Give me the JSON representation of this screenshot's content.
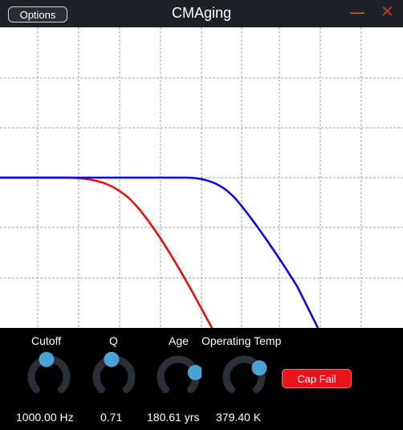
{
  "window": {
    "title": "CMAging"
  },
  "header": {
    "options_label": "Options",
    "minimize_glyph": "—",
    "close_glyph": "✕"
  },
  "plot": {
    "grid_color": "#a0a0a0",
    "curves": [
      {
        "color": "#ff0000"
      },
      {
        "color": "#0000ff"
      }
    ]
  },
  "knobs": [
    {
      "name": "cutoff",
      "label": "Cutoff",
      "value": "1000.00 Hz",
      "level": 0.47
    },
    {
      "name": "q",
      "label": "Q",
      "value": "0.71",
      "level": 0.47
    },
    {
      "name": "age",
      "label": "Age",
      "value": "180.61 yrs",
      "level": 0.78
    },
    {
      "name": "operating-temp",
      "label": "Operating Temp",
      "value": "379.40 K",
      "level": 0.72
    }
  ],
  "cap_fail": {
    "label": "Cap Fail",
    "color": "#e8141c"
  }
}
